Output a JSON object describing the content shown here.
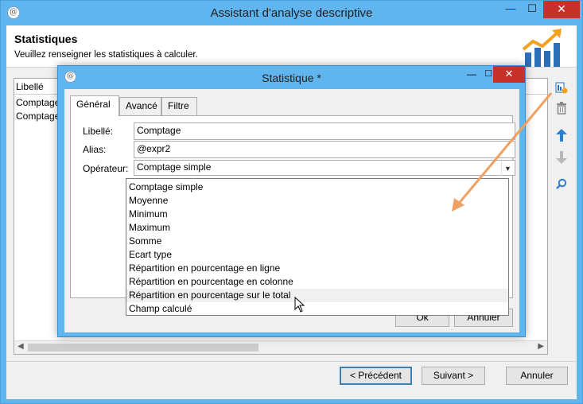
{
  "window": {
    "title": "Assistant d'analyse descriptive",
    "minimize": "—",
    "maximize": "☐",
    "close": "✕"
  },
  "header": {
    "title": "Statistiques",
    "subtitle": "Veuillez renseigner les statistiques à calculer."
  },
  "list": {
    "column": "Libellé",
    "rows": [
      "Comptage",
      "Comptage"
    ]
  },
  "footer": {
    "previous": "< Précédent",
    "next": "Suivant >",
    "cancel": "Annuler"
  },
  "dialog": {
    "title": "Statistique *",
    "tabs": [
      "Général",
      "Avancé",
      "Filtre"
    ],
    "fields": {
      "label_caption": "Libellé:",
      "label_value": "Comptage",
      "alias_caption": "Alias:",
      "alias_value": "@expr2",
      "operator_caption": "Opérateur:",
      "operator_value": "Comptage simple"
    },
    "ok": "Ok",
    "cancel": "Annuler",
    "operator_options": [
      "Comptage simple",
      "Moyenne",
      "Minimum",
      "Maximum",
      "Somme",
      "Ecart type",
      "Répartition en pourcentage en ligne",
      "Répartition en pourcentage en colonne",
      "Répartition en pourcentage sur le total",
      "Champ calculé"
    ],
    "hovered_option": "Répartition en pourcentage sur le total"
  },
  "colors": {
    "titlebar": "#60b5ee",
    "close": "#c7312a",
    "annotation_arrow": "#f0a060"
  }
}
